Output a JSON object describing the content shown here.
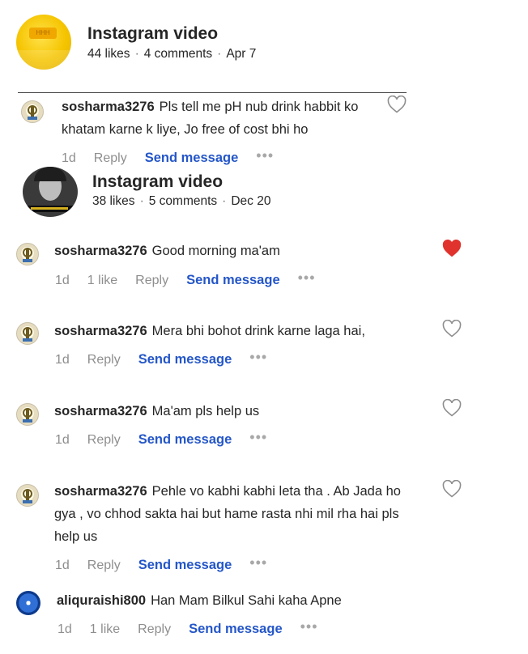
{
  "posts": [
    {
      "title": "Instagram video",
      "meta": {
        "likes": "44 likes",
        "comments": "4 comments",
        "date": "Apr 7"
      },
      "thumb_text": "HHH",
      "comments": [
        {
          "user": "sosharma3276",
          "text_line1": "Pls tell me pH nub drink habbit ko",
          "text_line2": "khatam karne k liye, Jo free of cost bhi ho",
          "time": "1d",
          "likes": "",
          "reply": "Reply",
          "send": "Send message",
          "more": "•••",
          "liked": false
        }
      ]
    },
    {
      "title": "Instagram video",
      "meta": {
        "likes": "38 likes",
        "comments": "5 comments",
        "date": "Dec 20"
      },
      "comments": [
        {
          "user": "sosharma3276",
          "text": "Good morning ma'am",
          "time": "1d",
          "likes": "1 like",
          "reply": "Reply",
          "send": "Send message",
          "more": "•••",
          "liked": true
        },
        {
          "user": "sosharma3276",
          "text": "Mera bhi bohot drink karne laga hai,",
          "time": "1d",
          "reply": "Reply",
          "send": "Send message",
          "more": "•••",
          "liked": false
        },
        {
          "user": "sosharma3276",
          "text": "Ma'am pls help us",
          "time": "1d",
          "reply": "Reply",
          "send": "Send message",
          "more": "•••",
          "liked": false
        },
        {
          "user": "sosharma3276",
          "text_line1": "Pehle vo kabhi kabhi leta tha . Ab Jada ho",
          "text_line2": "gya , vo chhod sakta hai but hame rasta nhi mil rha hai pls",
          "text_line3": "help us",
          "time": "1d",
          "reply": "Reply",
          "send": "Send message",
          "more": "•••",
          "liked": false
        },
        {
          "user": "aliquraishi800",
          "text": "Han Mam Bilkul Sahi kaha Apne",
          "time": "1d",
          "likes": "1 like",
          "reply": "Reply",
          "send": "Send message",
          "more": "•••",
          "liked": false
        }
      ]
    }
  ],
  "icons": {
    "heart": "heart-icon",
    "heart_filled": "heart-filled-icon",
    "more": "more-options-icon"
  },
  "colors": {
    "send_message": "#2456c8",
    "heart_liked": "#ed4956",
    "muted": "#8e8e8e"
  }
}
